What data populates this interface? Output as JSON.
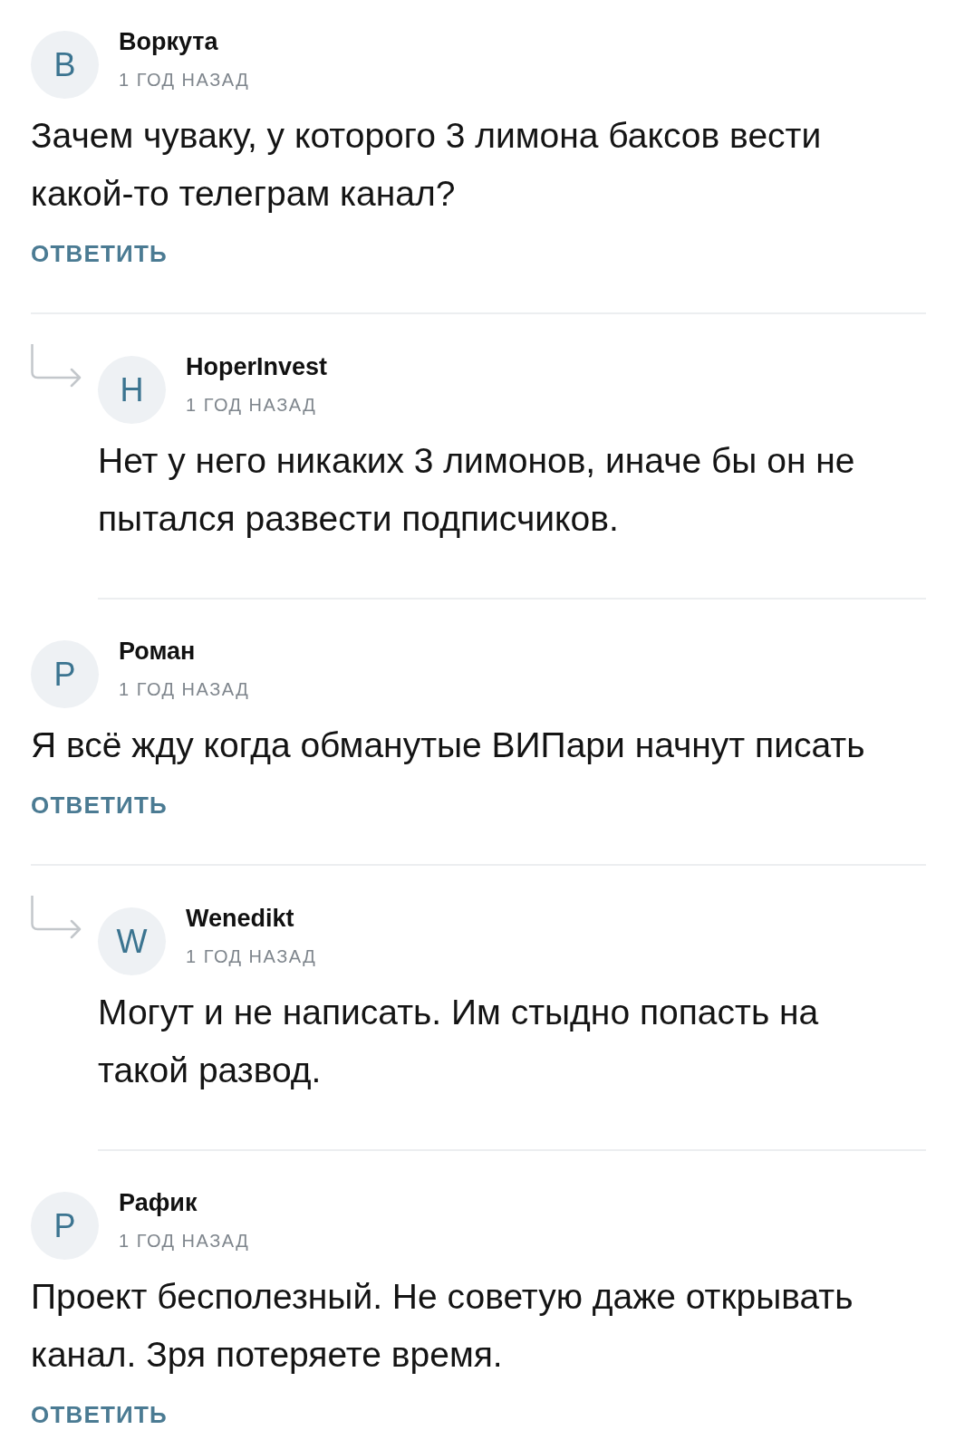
{
  "comments": [
    {
      "initial": "В",
      "author": "Воркута",
      "time": "1 ГОД НАЗАД",
      "text": "Зачем чуваку, у которого 3 лимона баксов вести какой-то телеграм канал?",
      "reply_button": "ОТВЕТИТЬ",
      "replies": [
        {
          "initial": "H",
          "author": "HoperInvest",
          "time": "1 ГОД НАЗАД",
          "text": "Нет у него никаких 3 лимонов, иначе бы он не пытался развести подписчиков."
        }
      ]
    },
    {
      "initial": "Р",
      "author": "Роман",
      "time": "1 ГОД НАЗАД",
      "text": "Я всё жду когда обманутые ВИПари начнут писать",
      "reply_button": "ОТВЕТИТЬ",
      "replies": [
        {
          "initial": "W",
          "author": "Wenedikt",
          "time": "1 ГОД НАЗАД",
          "text": "Могут и не написать. Им стыдно попасть на такой развод."
        }
      ]
    },
    {
      "initial": "Р",
      "author": "Рафик",
      "time": "1 ГОД НАЗАД",
      "text": "Проект бесполезный. Не советую даже открывать канал. Зря потеряете время.",
      "reply_button": "ОТВЕТИТЬ"
    }
  ]
}
